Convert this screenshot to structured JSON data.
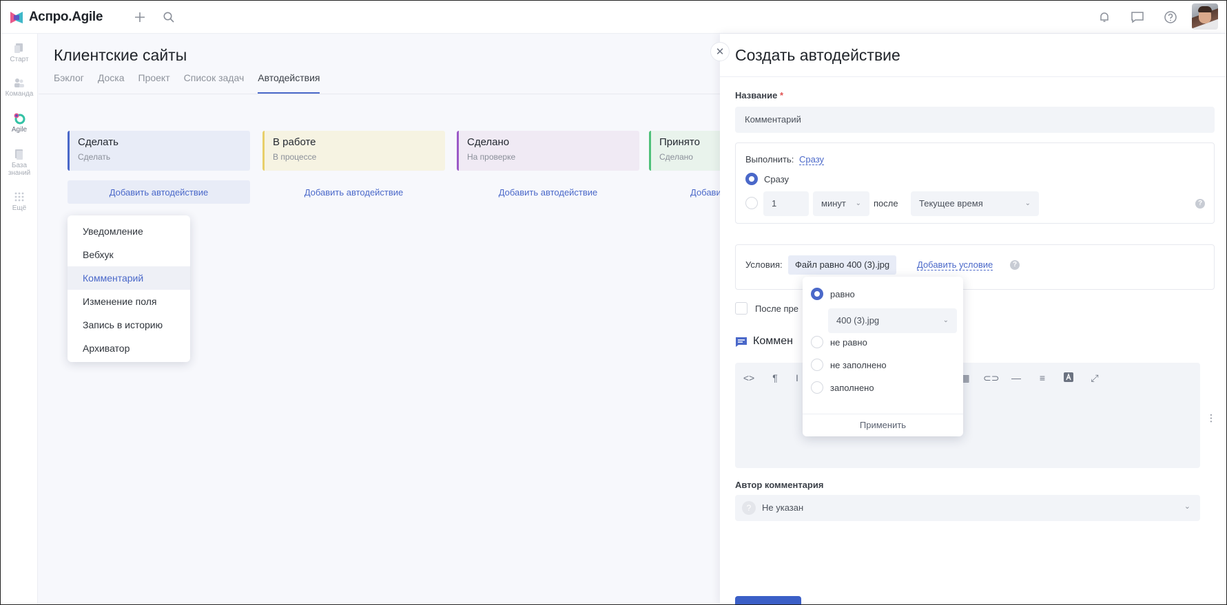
{
  "app": {
    "name": "Аспро.Agile"
  },
  "leftnav": {
    "items": [
      {
        "label": "Старт"
      },
      {
        "label": "Команда"
      },
      {
        "label": "Agile"
      },
      {
        "label": "База знаний"
      },
      {
        "label": "Ещё"
      }
    ]
  },
  "main": {
    "title": "Клиентские сайты",
    "tabs": [
      "Бэклог",
      "Доска",
      "Проект",
      "Список задач",
      "Автодействия"
    ],
    "active_tab": "Автодействия",
    "columns": [
      {
        "title": "Сделать",
        "subtitle": "Сделать",
        "add_label": "Добавить автодействие",
        "color": "#4a68c9",
        "bg": "#e8ecf7"
      },
      {
        "title": "В работе",
        "subtitle": "В процессе",
        "add_label": "Добавить автодействие",
        "color": "#e8cf6a",
        "bg": "#f6f3e2"
      },
      {
        "title": "Сделано",
        "subtitle": "На проверке",
        "add_label": "Добавить автодействие",
        "color": "#9b59c7",
        "bg": "#f0eaf4"
      },
      {
        "title": "Принято",
        "subtitle": "Сделано",
        "add_label": "Добави",
        "color": "#4fc17a",
        "bg": "#e9f3ec"
      }
    ],
    "action_menu": {
      "items": [
        "Уведомление",
        "Вебхук",
        "Комментарий",
        "Изменение поля",
        "Запись в историю",
        "Архиватор"
      ],
      "selected": "Комментарий"
    }
  },
  "panel": {
    "title": "Создать автодействие",
    "name_label": "Название",
    "required_mark": "*",
    "name_value": "Комментарий",
    "execute": {
      "label": "Выполнить:",
      "value_link": "Сразу",
      "option_now": "Сразу",
      "delay_value": "1",
      "delay_unit": "минут",
      "after_label": "после",
      "after_value": "Текущее время"
    },
    "conditions": {
      "label": "Условия:",
      "chip": "Файл равно 400 (3).jpg",
      "add_link": "Добавить условие"
    },
    "after_checkbox_label": "После пре",
    "comment_section_title": "Коммен",
    "author_label": "Автор комментария",
    "author_value": "Не указан",
    "author_avatar_glyph": "?"
  },
  "condition_popover": {
    "options": [
      "равно",
      "не равно",
      "не заполнено",
      "заполнено"
    ],
    "selected": "равно",
    "value": "400 (3).jpg",
    "apply_label": "Применить"
  },
  "colors": {
    "accent": "#4a68c9",
    "save_button": "#3b5fc7"
  }
}
